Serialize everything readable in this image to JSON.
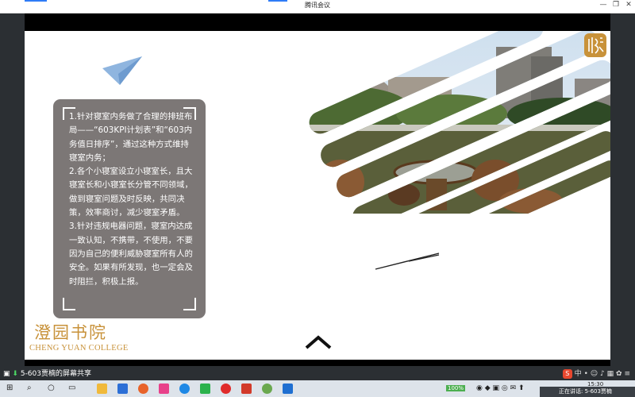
{
  "window": {
    "title": "腾讯会议",
    "minimize_glyph": "—",
    "restore_glyph": "❐",
    "close_glyph": "✕"
  },
  "slide": {
    "body_paragraphs": [
      "1.针对寝室内务做了合理的排班布局——“603KPI计划表”和“603内务值日排序”，通过这种方式维持寝室内务；",
      "2.各个小寝室设立小寝室长，且大寝室长和小寝室长分管不同领域，做到寝室问题及时反映，共同决策，效率商讨，减少寝室矛盾。",
      "3.针对违规电器问题，寝室内达成一致认知，不携带，不使用，不要因为自己的便利威胁寝室所有人的安全。如果有所发现，也一定会及时阻拦，积极上报。"
    ],
    "college_cn": "澄园书院",
    "college_en": "CHENG YUAN COLLEGE"
  },
  "share_bar": {
    "label": "5-603贾楠的屏幕共享"
  },
  "taskbar": {
    "battery": "100%",
    "time": "15:30",
    "notification": "正在讲话: 5-603贾楠"
  },
  "colors": {
    "accent": "#2f7cf6",
    "textbox": "#7c7776",
    "college_gold": "#c8923a",
    "plane_blue": "#8fb5df"
  }
}
